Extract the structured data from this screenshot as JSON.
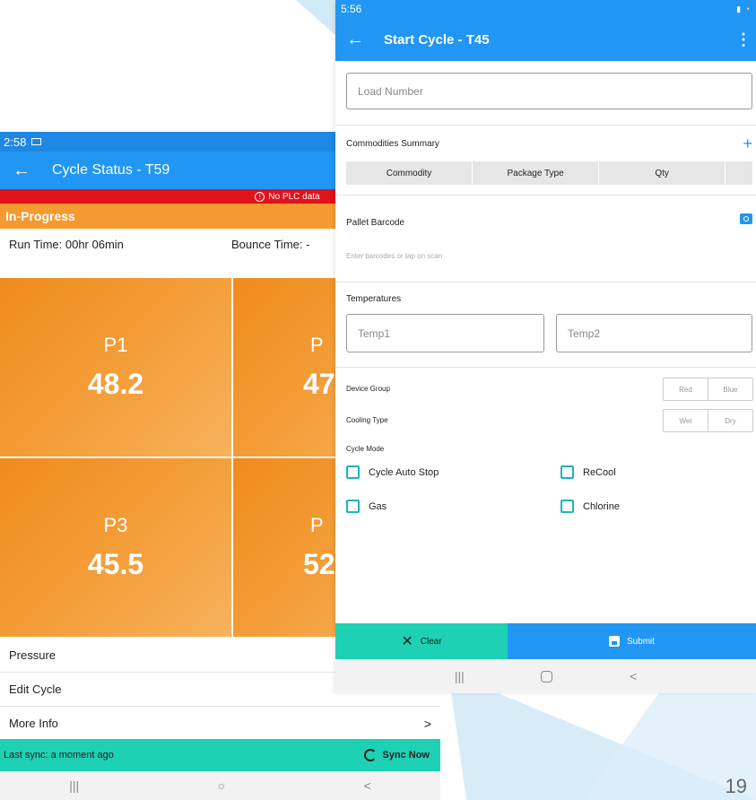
{
  "page_number": "19",
  "colors": {
    "primary": "#2196f3",
    "accent": "#1fd1b4",
    "warning_orange": "#f59a30",
    "error_red": "#e0121c"
  },
  "cycle_status": {
    "status_time": "2:58",
    "title": "Cycle Status - T59",
    "alert": "No PLC data",
    "state": "In-Progress",
    "run_time": "Run Time: 00hr 06min",
    "bounce_time": "Bounce Time: -",
    "tiles": [
      {
        "name": "P1",
        "value": "48.2"
      },
      {
        "name": "P",
        "value": "47"
      },
      {
        "name": "P3",
        "value": "45.5"
      },
      {
        "name": "P",
        "value": "52"
      }
    ],
    "menu": [
      {
        "label": "Pressure",
        "chevron": ""
      },
      {
        "label": "Edit Cycle",
        "chevron": ""
      },
      {
        "label": "More Info",
        "chevron": ">"
      }
    ],
    "last_sync": "Last sync: a moment ago",
    "sync_now": "Sync Now",
    "nav": [
      "|||",
      "○",
      "<"
    ]
  },
  "start_cycle": {
    "status_time": "5:56",
    "title": "Start Cycle - T45",
    "load_number_placeholder": "Load Number",
    "commodities_summary": "Commodities Summary",
    "table_headers": [
      "Commodity",
      "Package Type",
      "Qty"
    ],
    "pallet_barcode": "Pallet Barcode",
    "barcode_hint": "Enter barcodes or tap on scan",
    "temperatures": "Temperatures",
    "temp1_placeholder": "Temp1",
    "temp2_placeholder": "Temp2",
    "device_group_label": "Device Group",
    "device_group_options": [
      "Red",
      "Blue"
    ],
    "cooling_type_label": "Cooling Type",
    "cooling_type_options": [
      "Wet",
      "Dry"
    ],
    "cycle_mode_label": "Cycle Mode",
    "modes": [
      "Cycle Auto Stop",
      "ReCool",
      "Gas",
      "Chlorine"
    ],
    "clear_label": "Clear",
    "submit_label": "Submit",
    "nav": [
      "|||",
      "<"
    ]
  }
}
